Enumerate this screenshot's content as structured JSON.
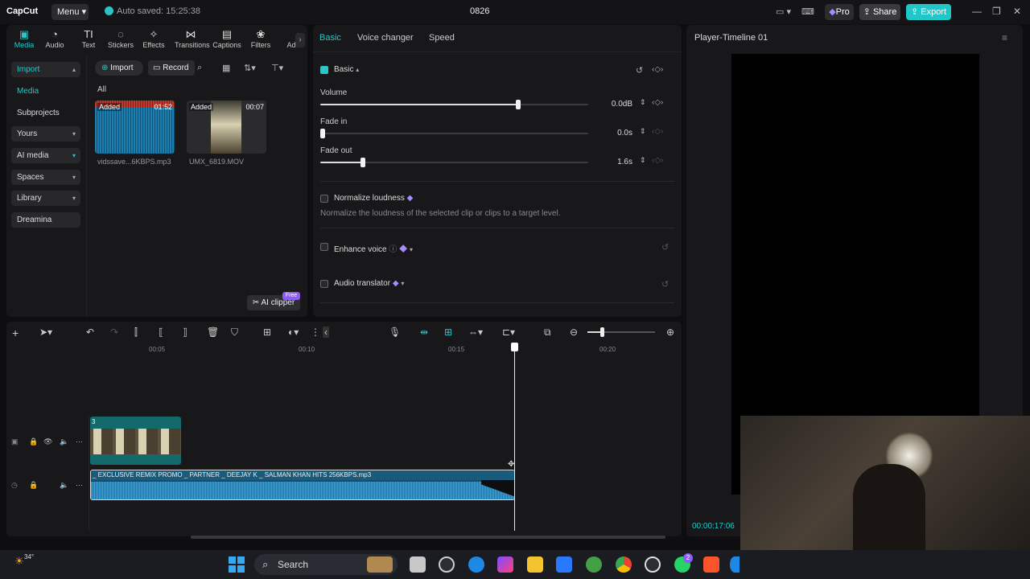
{
  "app": {
    "logo": "CapCut",
    "menu_label": "Menu",
    "autosave": "Auto saved: 15:25:38",
    "title": "0826",
    "pro_label": "Pro",
    "share_label": "Share",
    "export_label": "Export"
  },
  "toolbar": [
    {
      "label": "Media",
      "icon": "▣"
    },
    {
      "label": "Audio",
      "icon": "◔"
    },
    {
      "label": "Text",
      "icon": "TI"
    },
    {
      "label": "Stickers",
      "icon": "◌"
    },
    {
      "label": "Effects",
      "icon": "✧"
    },
    {
      "label": "Transitions",
      "icon": "⋈"
    },
    {
      "label": "Captions",
      "icon": "▤"
    },
    {
      "label": "Filters",
      "icon": "❀"
    },
    {
      "label": "Ad",
      "icon": ""
    }
  ],
  "sidebar": [
    {
      "label": "Import"
    },
    {
      "label": "Media"
    },
    {
      "label": "Subprojects"
    },
    {
      "label": "Yours"
    },
    {
      "label": "AI media"
    },
    {
      "label": "Spaces"
    },
    {
      "label": "Library"
    },
    {
      "label": "Dreamina"
    }
  ],
  "media": {
    "import_btn": "Import",
    "record_btn": "Record",
    "filter_all": "All",
    "items": [
      {
        "tag": "Added",
        "duration": "01:52",
        "name": "vidssave...6KBPS.mp3"
      },
      {
        "tag": "Added",
        "duration": "00:07",
        "name": "UMX_6819.MOV"
      }
    ],
    "ai_clipper": "AI clipper",
    "free_badge": "Free"
  },
  "props": {
    "tabs": [
      "Basic",
      "Voice changer",
      "Speed"
    ],
    "section": "Basic",
    "volume": {
      "label": "Volume",
      "value": "0.0dB",
      "level": 0.74
    },
    "fade_in": {
      "label": "Fade in",
      "value": "0.0s",
      "level": 0.0
    },
    "fade_out": {
      "label": "Fade out",
      "value": "1.6s",
      "level": 0.16
    },
    "normalize": {
      "label": "Normalize loudness",
      "desc": "Normalize the loudness of the selected clip or clips to a target level."
    },
    "enhance": {
      "label": "Enhance voice"
    },
    "translator": {
      "label": "Audio translator"
    }
  },
  "player": {
    "title": "Player-Timeline 01",
    "timecode": "00:00:17:06"
  },
  "timeline": {
    "ruler": [
      "00:05",
      "00:10",
      "00:15",
      "00:20"
    ],
    "video_clip_label": "3",
    "audio_clip_label": "_ EXCLUSIVE REMIX PROMO _ PARTNER _ DEEJAY K _ SALMAN KHAN HITS 256KBPS.mp3"
  },
  "taskbar": {
    "weather": "34°",
    "search": "Search",
    "badge": "2"
  }
}
